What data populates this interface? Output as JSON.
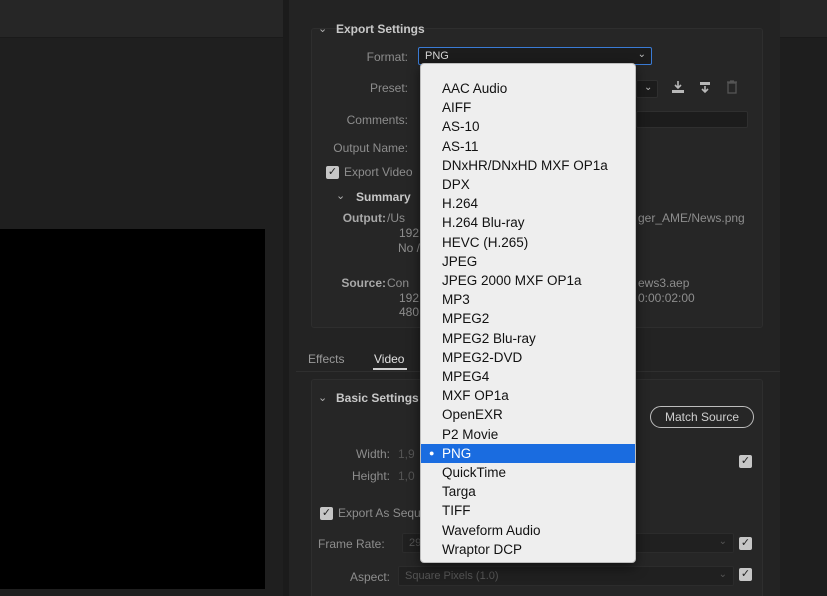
{
  "export_settings": {
    "title": "Export Settings",
    "format_label": "Format:",
    "format_value": "PNG",
    "preset_label": "Preset:",
    "comments_label": "Comments:",
    "output_name_label": "Output Name:",
    "output_name_suffix": "ger_AME/News.png",
    "export_video_label": "Export Video",
    "export_video_checked": true
  },
  "summary": {
    "title": "Summary",
    "output_label": "Output:",
    "output_line1": "/Us",
    "output_line2": "192",
    "output_line3": "No /",
    "output_suffix": "ger_AME/News.png",
    "source_label": "Source:",
    "source_line1": "Con",
    "source_line2": "192",
    "source_line3": "480",
    "source_suffix1": "ews3.aep",
    "source_suffix2": "0:00:02:00"
  },
  "tabs": [
    {
      "label": "Effects",
      "active": false
    },
    {
      "label": "Video",
      "active": true
    }
  ],
  "basic_settings": {
    "title": "Basic Settings",
    "match_source_label": "Match Source",
    "width_label": "Width:",
    "width_value": "1,9",
    "height_label": "Height:",
    "height_value": "1,0",
    "export_as_sequence_label": "Export As Sequ",
    "frame_rate_label": "Frame Rate:",
    "frame_rate_value": "29",
    "aspect_label": "Aspect:",
    "aspect_value": "Square Pixels (1.0)"
  },
  "format_dropdown": {
    "selected": "PNG",
    "options": [
      "AAC Audio",
      "AIFF",
      "AS-10",
      "AS-11",
      "DNxHR/DNxHD MXF OP1a",
      "DPX",
      "H.264",
      "H.264 Blu-ray",
      "HEVC (H.265)",
      "JPEG",
      "JPEG 2000 MXF OP1a",
      "MP3",
      "MPEG2",
      "MPEG2 Blu-ray",
      "MPEG2-DVD",
      "MPEG4",
      "MXF OP1a",
      "OpenEXR",
      "P2 Movie",
      "PNG",
      "QuickTime",
      "Targa",
      "TIFF",
      "Waveform Audio",
      "Wraptor DCP"
    ]
  },
  "icons": {
    "save_preset": "download-icon",
    "import_preset": "import-icon",
    "delete_preset": "trash-icon"
  },
  "colors": {
    "selection": "#1a6ce0",
    "focus_border": "#3a7bd5"
  }
}
